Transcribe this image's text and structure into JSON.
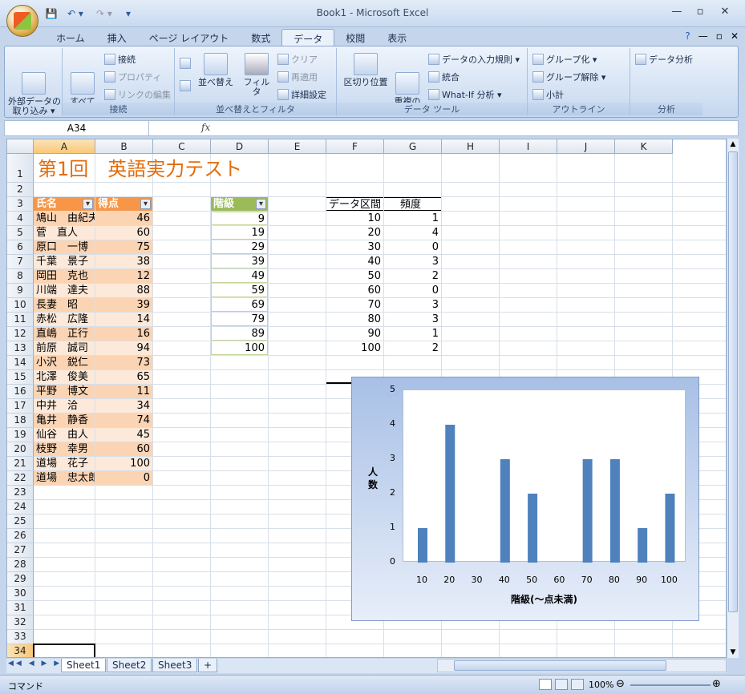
{
  "window": {
    "title": "Book1 - Microsoft Excel",
    "minimize": "—",
    "maximize": "▫",
    "close": "✕",
    "qat_save": "💾",
    "qat_undo": "↶ ▾",
    "qat_redo": "↷ ▾",
    "qat_custom": "▾"
  },
  "tabs": [
    "ホーム",
    "挿入",
    "ページ レイアウト",
    "数式",
    "データ",
    "校閲",
    "表示"
  ],
  "active_tab": "データ",
  "ribbon": {
    "external_data": "外部データの\n取り込み ▾",
    "refresh_all": "すべて\n更新 ▾",
    "connections": "接続",
    "properties": "プロパティ",
    "edit_links": "リンクの編集",
    "group_connections": "接続",
    "sort_az": "A→Z",
    "sort_za": "Z→A",
    "sort": "並べ替え",
    "filter": "フィルタ",
    "clear": "クリア",
    "reapply": "再適用",
    "advanced": "詳細設定",
    "group_sort": "並べ替えとフィルタ",
    "text_to_columns": "区切り位置",
    "remove_duplicates": "重複の\n削除",
    "data_validation": "データの入力規則 ▾",
    "consolidate": "統合",
    "what_if": "What-If 分析 ▾",
    "group_tools": "データ ツール",
    "group_btn": "グループ化 ▾",
    "ungroup_btn": "グループ解除 ▾",
    "subtotal": "小計",
    "group_outline": "アウトライン",
    "data_analysis": "データ分析",
    "group_analysis": "分析"
  },
  "formula_bar": {
    "name_box": "A34",
    "fx": "fx",
    "value": ""
  },
  "columns": [
    "A",
    "B",
    "C",
    "D",
    "E",
    "F",
    "G",
    "H",
    "I",
    "J",
    "K"
  ],
  "rows": [
    "1",
    "2",
    "3",
    "4",
    "5",
    "6",
    "7",
    "8",
    "9",
    "10",
    "11",
    "12",
    "13",
    "14",
    "15",
    "16",
    "17",
    "18",
    "19",
    "20",
    "21",
    "22",
    "23",
    "24",
    "25",
    "26",
    "27",
    "28",
    "29",
    "30",
    "31",
    "32",
    "33",
    "34"
  ],
  "sheet": {
    "title": "第1回　英語実力テスト",
    "headers": {
      "name": "氏名",
      "score": "得点",
      "class": "階級",
      "bin": "データ区間",
      "freq": "頻度"
    },
    "students": [
      {
        "name": "鳩山　由紀夫",
        "score": "46"
      },
      {
        "name": "菅　直人",
        "score": "60"
      },
      {
        "name": "原口　一博",
        "score": "75"
      },
      {
        "name": "千葉　景子",
        "score": "38"
      },
      {
        "name": "岡田　克也",
        "score": "12"
      },
      {
        "name": "川端　達夫",
        "score": "88"
      },
      {
        "name": "長妻　昭",
        "score": "39"
      },
      {
        "name": "赤松　広隆",
        "score": "14"
      },
      {
        "name": "直嶋　正行",
        "score": "16"
      },
      {
        "name": "前原　誠司",
        "score": "94"
      },
      {
        "name": "小沢　鋭仁",
        "score": "73"
      },
      {
        "name": "北澤　俊美",
        "score": "65"
      },
      {
        "name": "平野　博文",
        "score": "11"
      },
      {
        "name": "中井　洽",
        "score": "34"
      },
      {
        "name": "亀井　静香",
        "score": "74"
      },
      {
        "name": "仙谷　由人",
        "score": "45"
      },
      {
        "name": "枝野　幸男",
        "score": "60"
      },
      {
        "name": "道場　花子",
        "score": "100"
      },
      {
        "name": "道場　忠太郎",
        "score": "0"
      }
    ],
    "classes": [
      "9",
      "19",
      "29",
      "39",
      "49",
      "59",
      "69",
      "79",
      "89",
      "100"
    ],
    "bins": [
      "10",
      "20",
      "30",
      "40",
      "50",
      "60",
      "70",
      "80",
      "90",
      "100"
    ],
    "freqs": [
      "1",
      "4",
      "0",
      "3",
      "2",
      "0",
      "3",
      "3",
      "1",
      "2"
    ]
  },
  "chart_data": {
    "type": "bar",
    "categories": [
      "10",
      "20",
      "30",
      "40",
      "50",
      "60",
      "70",
      "80",
      "90",
      "100"
    ],
    "values": [
      1,
      4,
      0,
      3,
      2,
      0,
      3,
      3,
      1,
      2
    ],
    "xlabel": "階級(～点未満)",
    "ylabel": "人\n数",
    "ylim": [
      0,
      5
    ],
    "yticks": [
      "0",
      "1",
      "2",
      "3",
      "4",
      "5"
    ],
    "bar_color": "#4f81bd"
  },
  "sheet_tabs": [
    "Sheet1",
    "Sheet2",
    "Sheet3"
  ],
  "status": {
    "mode": "コマンド",
    "zoom": "100%"
  },
  "colors": {
    "header_orange": "#f79646",
    "row_orange": "#fde9d9",
    "row_orange_alt": "#fbd4b4",
    "header_green": "#9bbb59",
    "title_orange": "#e36c0a"
  }
}
